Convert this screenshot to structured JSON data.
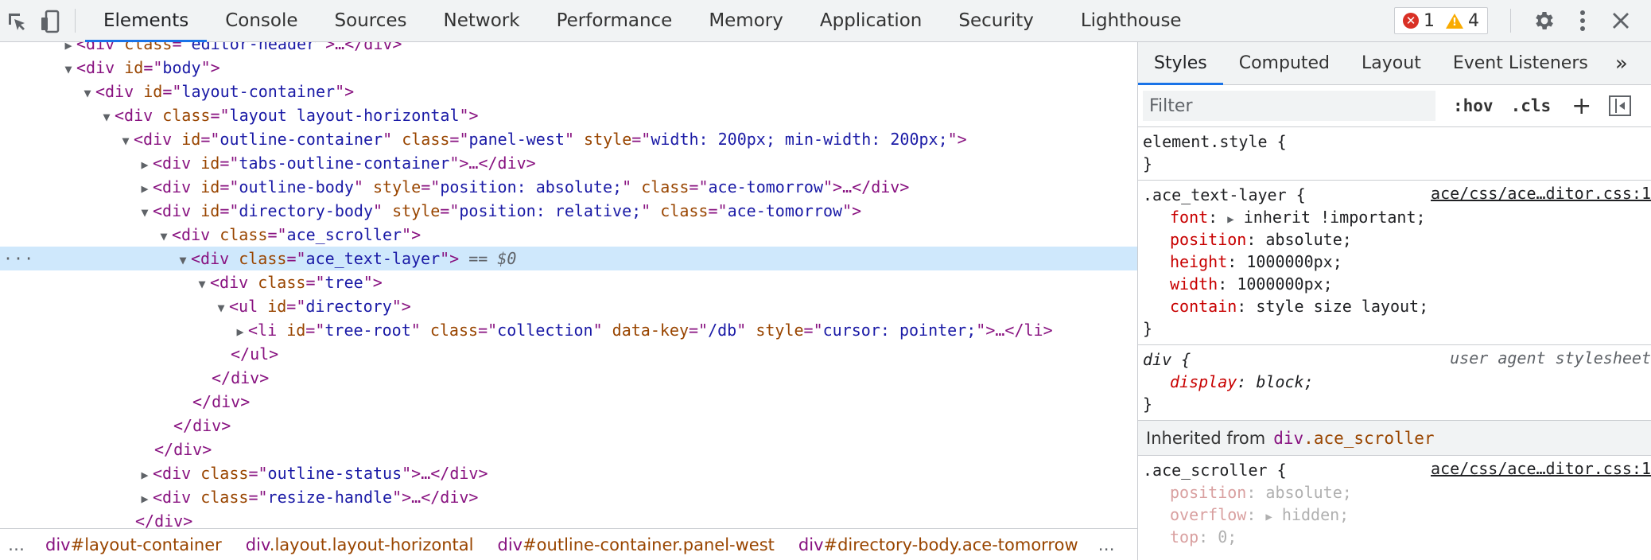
{
  "toolbar": {
    "tabs": [
      "Elements",
      "Console",
      "Sources",
      "Network",
      "Performance",
      "Memory",
      "Application",
      "Security",
      "Lighthouse"
    ],
    "error_count": "1",
    "warning_count": "4"
  },
  "dom": {
    "l0": {
      "tag": "div",
      "attr": "class",
      "val": "editor-header",
      "tail": ">…</div>"
    },
    "l1": {
      "tag": "div",
      "attr": "id",
      "val": "body"
    },
    "l2": {
      "tag": "div",
      "attr": "id",
      "val": "layout-container"
    },
    "l3": {
      "tag": "div",
      "attr": "class",
      "val": "layout layout-horizontal"
    },
    "l4": {
      "tag": "div",
      "a1": "id",
      "v1": "outline-container",
      "a2": "class",
      "v2": "panel-west",
      "a3": "style",
      "v3": "width: 200px; min-width: 200px;"
    },
    "l5": {
      "tag": "div",
      "attr": "id",
      "val": "tabs-outline-container",
      "tail": "…</div>"
    },
    "l6": {
      "tag": "div",
      "a1": "id",
      "v1": "outline-body",
      "a2": "style",
      "v2": "position: absolute;",
      "a3": "class",
      "v3": "ace-tomorrow",
      "tail": "…</div>"
    },
    "l7": {
      "tag": "div",
      "a1": "id",
      "v1": "directory-body",
      "a2": "style",
      "v2": "position: relative;",
      "a3": "class",
      "v3": "ace-tomorrow"
    },
    "l8": {
      "tag": "div",
      "attr": "class",
      "val": "ace_scroller"
    },
    "l9": {
      "tag": "div",
      "attr": "class",
      "val": "ace_text-layer",
      "marker": "== $0"
    },
    "l10": {
      "tag": "div",
      "attr": "class",
      "val": "tree"
    },
    "l11": {
      "tag": "ul",
      "attr": "id",
      "val": "directory"
    },
    "l12": {
      "tag": "li",
      "a1": "id",
      "v1": "tree-root",
      "a2": "class",
      "v2": "collection",
      "a3": "data-key",
      "v3": "/db",
      "a4": "style",
      "v4": "cursor: pointer;",
      "tail": "…</li>"
    },
    "l13": "</ul>",
    "l14": "</div>",
    "l15": "</div>",
    "l16": "</div>",
    "l17": "</div>",
    "l18": {
      "tag": "div",
      "attr": "class",
      "val": "outline-status",
      "tail": "…</div>"
    },
    "l19": {
      "tag": "div",
      "attr": "class",
      "val": "resize-handle",
      "tail": "…</div>"
    },
    "l20": "</div>"
  },
  "breadcrumbs": [
    {
      "tag": "div",
      "rest": "#layout-container"
    },
    {
      "tag": "div",
      "rest": ".layout.layout-horizontal"
    },
    {
      "tag": "div",
      "rest": "#outline-container.panel-west"
    },
    {
      "tag": "div",
      "rest": "#directory-body.ace-tomorrow"
    }
  ],
  "sidebar": {
    "tabs": [
      "Styles",
      "Computed",
      "Layout",
      "Event Listeners"
    ],
    "more": "»",
    "filter_placeholder": "Filter",
    "hov": ":hov",
    "cls": ".cls",
    "plus": "+"
  },
  "rules": {
    "element_style": {
      "selector": "element.style {",
      "close": "}"
    },
    "ace_text_layer": {
      "selector": ".ace_text-layer {",
      "source": "ace/css/ace…ditor.css:1",
      "props": [
        {
          "name": "font",
          "value": "inherit !important;",
          "expand": "▶"
        },
        {
          "name": "position",
          "value": "absolute;"
        },
        {
          "name": "height",
          "value": "1000000px;"
        },
        {
          "name": "width",
          "value": "1000000px;"
        },
        {
          "name": "contain",
          "value": "style size layout;"
        }
      ],
      "close": "}"
    },
    "div_ua": {
      "selector": "div {",
      "source": "user agent stylesheet",
      "prop": "display",
      "value": "block;",
      "close": "}"
    },
    "inherited": {
      "label": "Inherited from",
      "tag": "div",
      "rest": ".ace_scroller"
    },
    "ace_scroller": {
      "selector": ".ace_scroller {",
      "source": "ace/css/ace…ditor.css:1",
      "props": [
        {
          "name": "position",
          "value": "absolute;"
        },
        {
          "name": "overflow",
          "value": "hidden;",
          "expand": "▶"
        },
        {
          "name": "top",
          "value": "0;"
        }
      ]
    }
  }
}
